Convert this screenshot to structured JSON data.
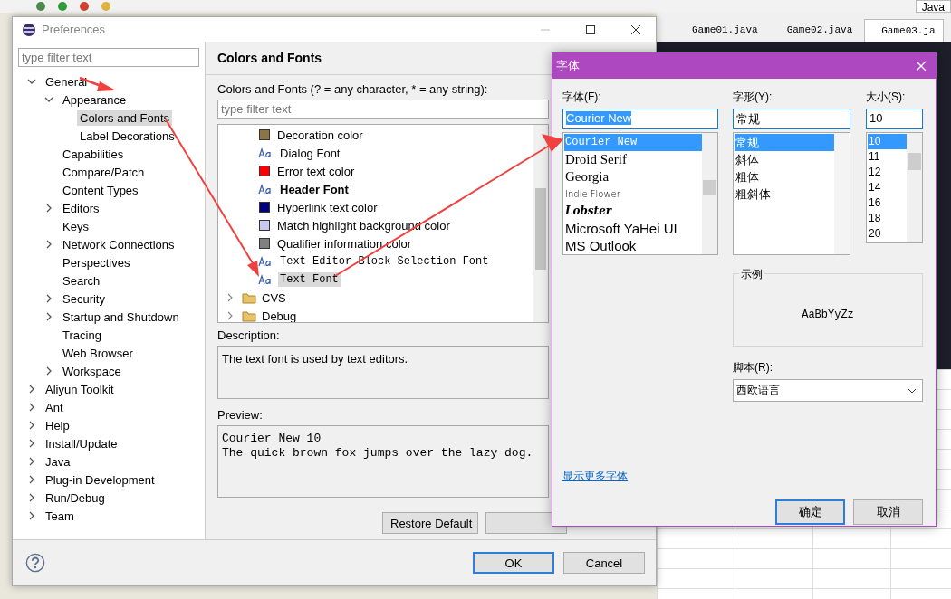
{
  "ide": {
    "perspective": "Java",
    "editor_tabs": [
      {
        "label": "Game01.java",
        "selected": false
      },
      {
        "label": "Game02.java",
        "selected": false
      },
      {
        "label": "Game03.ja",
        "selected": true
      }
    ]
  },
  "preferences": {
    "title": "Preferences",
    "filter_placeholder": "type filter text",
    "tree": [
      {
        "label": "General",
        "expanded": true,
        "selected": false,
        "children": [
          {
            "label": "Appearance",
            "expanded": true,
            "selected": false,
            "children": [
              {
                "label": "Colors and Fonts",
                "selected": true
              },
              {
                "label": "Label Decorations",
                "selected": false
              }
            ]
          },
          {
            "label": "Capabilities",
            "selected": false
          },
          {
            "label": "Compare/Patch",
            "selected": false
          },
          {
            "label": "Content Types",
            "selected": false
          },
          {
            "label": "Editors",
            "expanded": false,
            "selected": false
          },
          {
            "label": "Keys",
            "selected": false
          },
          {
            "label": "Network Connections",
            "expanded": false,
            "selected": false
          },
          {
            "label": "Perspectives",
            "selected": false
          },
          {
            "label": "Search",
            "selected": false
          },
          {
            "label": "Security",
            "expanded": false,
            "selected": false
          },
          {
            "label": "Startup and Shutdown",
            "expanded": false,
            "selected": false
          },
          {
            "label": "Tracing",
            "selected": false
          },
          {
            "label": "Web Browser",
            "selected": false
          },
          {
            "label": "Workspace",
            "expanded": false,
            "selected": false
          }
        ]
      },
      {
        "label": "Aliyun Toolkit",
        "expanded": false,
        "selected": false
      },
      {
        "label": "Ant",
        "expanded": false,
        "selected": false
      },
      {
        "label": "Help",
        "expanded": false,
        "selected": false
      },
      {
        "label": "Install/Update",
        "expanded": false,
        "selected": false
      },
      {
        "label": "Java",
        "expanded": false,
        "selected": false
      },
      {
        "label": "Plug-in Development",
        "expanded": false,
        "selected": false
      },
      {
        "label": "Run/Debug",
        "expanded": false,
        "selected": false
      },
      {
        "label": "Team",
        "expanded": false,
        "selected": false
      }
    ],
    "page_title": "Colors and Fonts",
    "list_label": "Colors and Fonts (? = any character, * = any string):",
    "list_filter_placeholder": "type filter text",
    "items": [
      {
        "kind": "color",
        "label": "Decoration color",
        "color": "#8b7445",
        "selected": false
      },
      {
        "kind": "font",
        "label": "Dialog Font",
        "selected": false
      },
      {
        "kind": "color",
        "label": "Error text color",
        "color": "#ff0000",
        "selected": false
      },
      {
        "kind": "bold_font",
        "label": "Header Font",
        "selected": false
      },
      {
        "kind": "color",
        "label": "Hyperlink text color",
        "color": "#000080",
        "selected": false
      },
      {
        "kind": "color",
        "label": "Match highlight background color",
        "color": "#c8c8f0",
        "selected": false
      },
      {
        "kind": "color",
        "label": "Qualifier information color",
        "color": "#808080",
        "selected": false
      },
      {
        "kind": "mono_font",
        "label": "Text Editor Block Selection Font",
        "selected": false
      },
      {
        "kind": "mono_font",
        "label": "Text Font",
        "selected": true
      }
    ],
    "folders": [
      {
        "label": "CVS",
        "expanded": false
      },
      {
        "label": "Debug",
        "expanded": false
      }
    ],
    "description_label": "Description:",
    "description": "The text font is used by text editors.",
    "preview_label": "Preview:",
    "preview_lines": [
      "Courier New 10",
      "The quick brown fox jumps over the lazy dog."
    ],
    "restore_button": "Restore Default",
    "ok_button": "OK",
    "cancel_button": "Cancel"
  },
  "font_dialog": {
    "title": "字体",
    "font_label": "字体(F):",
    "font_value": "Courier New",
    "fonts": [
      {
        "label": "Courier New",
        "kind": "mono",
        "selected": true
      },
      {
        "label": "Droid Serif",
        "kind": "serif",
        "selected": false
      },
      {
        "label": "Georgia",
        "kind": "serif",
        "selected": false
      },
      {
        "label": "Indie Flower",
        "kind": "hand",
        "selected": false
      },
      {
        "label": "Lobster",
        "kind": "script",
        "selected": false
      },
      {
        "label": "Microsoft YaHei UI",
        "kind": "sans",
        "selected": false
      },
      {
        "label": "MS Outlook",
        "kind": "sans",
        "selected": false
      }
    ],
    "style_label": "字形(Y):",
    "style_value": "常规",
    "styles": [
      {
        "label": "常规",
        "selected": true
      },
      {
        "label": "斜体",
        "selected": false
      },
      {
        "label": "粗体",
        "selected": false
      },
      {
        "label": "粗斜体",
        "selected": false
      }
    ],
    "size_label": "大小(S):",
    "size_value": "10",
    "sizes": [
      {
        "label": "10",
        "selected": true
      },
      {
        "label": "11",
        "selected": false
      },
      {
        "label": "12",
        "selected": false
      },
      {
        "label": "14",
        "selected": false
      },
      {
        "label": "16",
        "selected": false
      },
      {
        "label": "18",
        "selected": false
      },
      {
        "label": "20",
        "selected": false
      }
    ],
    "sample_label": "示例",
    "sample_text": "AaBbYyZz",
    "script_label": "脚本(R):",
    "script_value": "西欧语言",
    "more_fonts_link": "显示更多字体",
    "ok_button": "确定",
    "cancel_button": "取消"
  }
}
